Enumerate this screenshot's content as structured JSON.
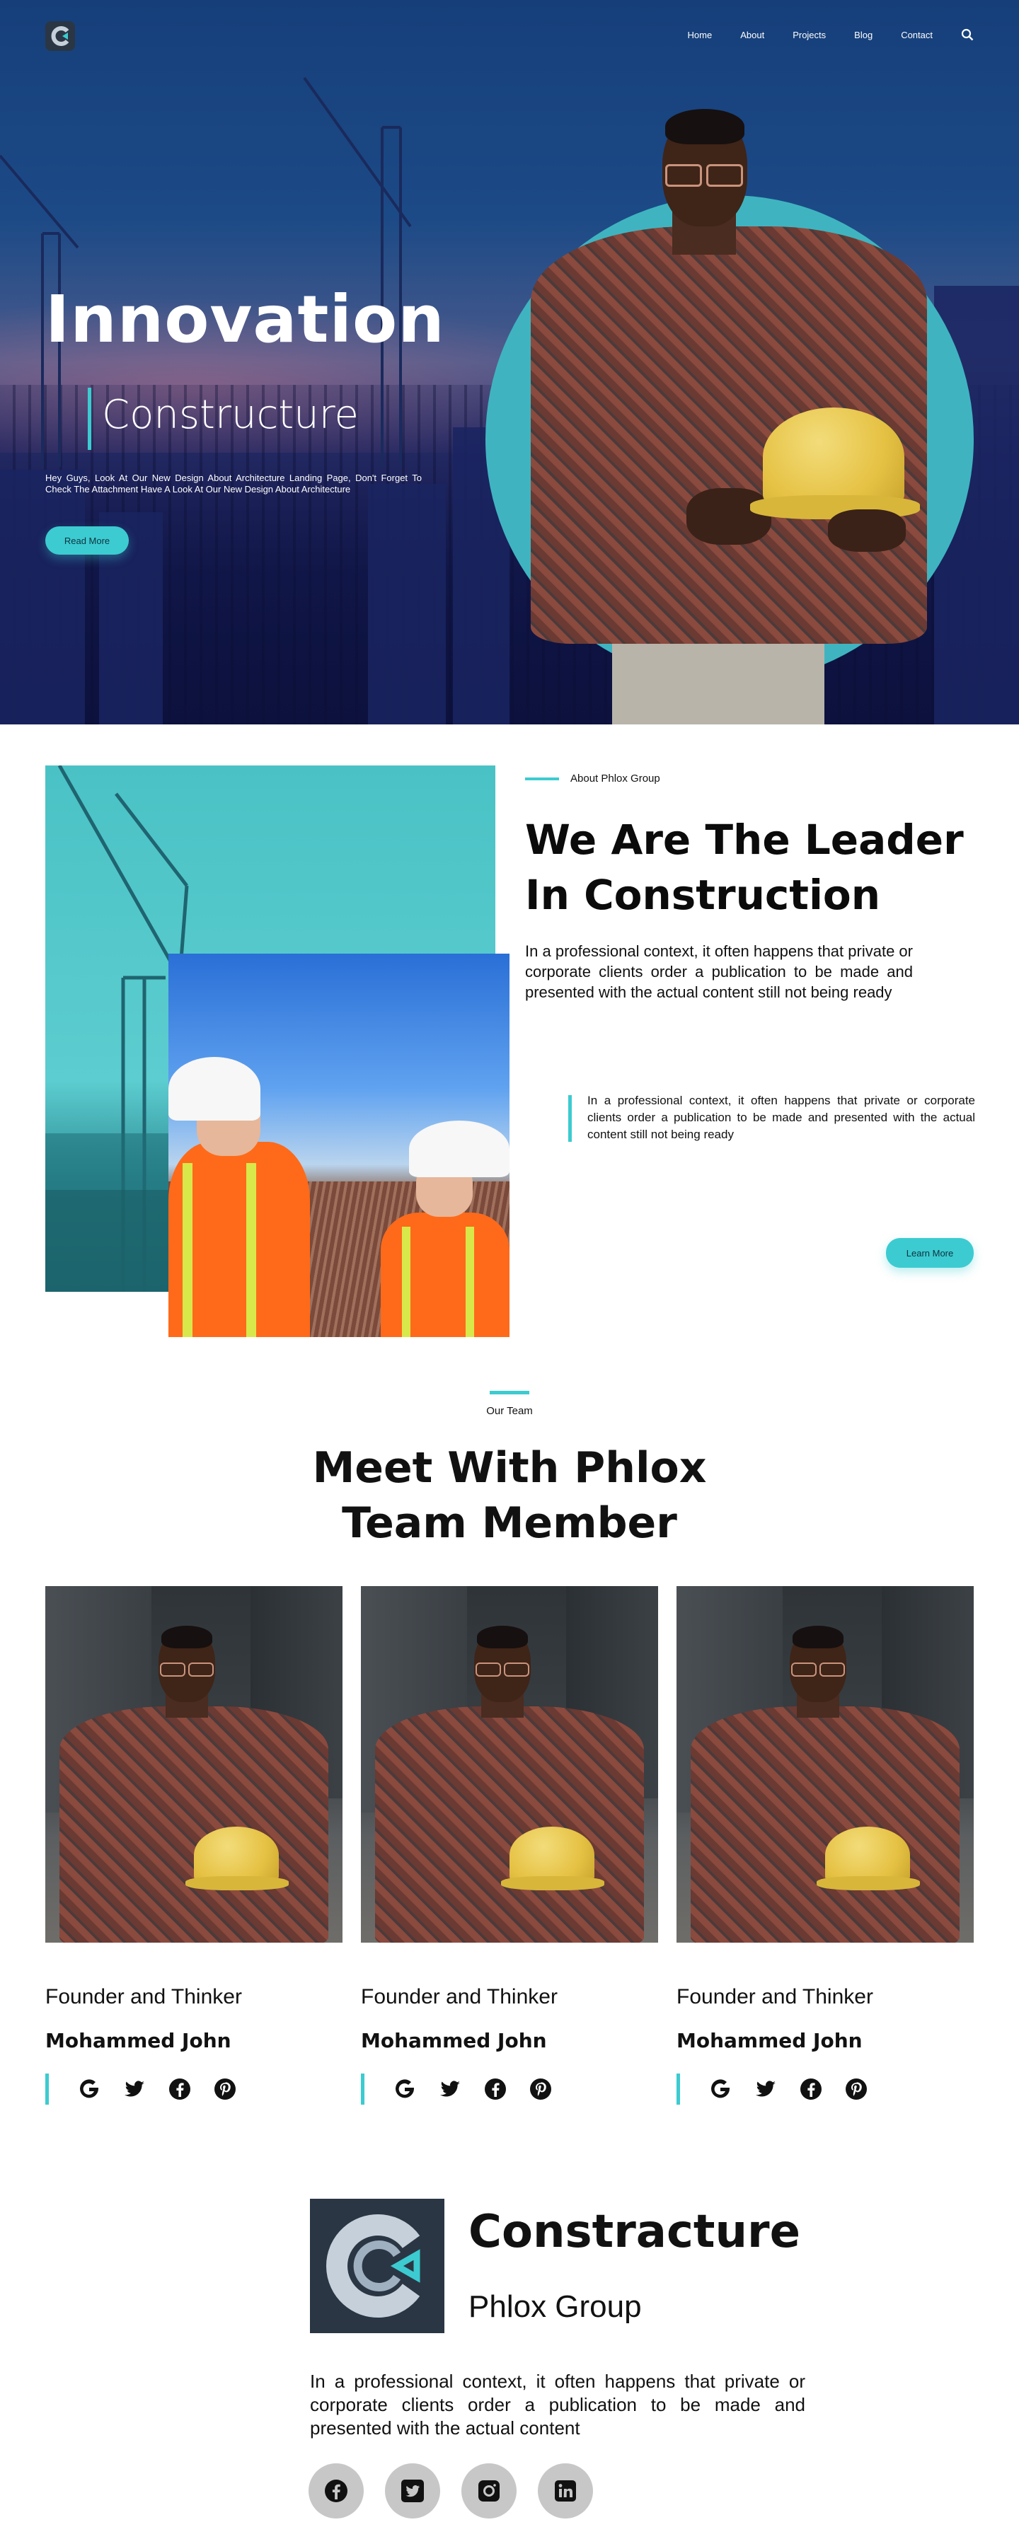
{
  "nav": {
    "items": [
      "Home",
      "About",
      "Projects",
      "Blog",
      "Contact"
    ]
  },
  "hero": {
    "title": "Innovation",
    "subtitle": "Constructure",
    "text": "Hey Guys, Look At Our New Design About Architecture Landing Page, Don't Forget To Check The Attachment Have A Look At Our New Design About Architecture",
    "button": "Read More"
  },
  "about": {
    "eyebrow": "About Phlox Group",
    "title": "We Are The Leader In Construction",
    "paragraph": "In a professional context, it often happens that private or corporate clients order a publication to be made and presented with the actual content still not being ready",
    "quote": "In a professional context, it often happens that private or corporate clients order a publication to be made and presented with the actual content still not being ready",
    "button": "Learn More"
  },
  "team": {
    "eyebrow": "Our Team",
    "title": "Meet With Phlox Team Member",
    "members": [
      {
        "role": "Founder and Thinker",
        "name": "Mohammed John"
      },
      {
        "role": "Founder and Thinker",
        "name": "Mohammed John"
      },
      {
        "role": "Founder and Thinker",
        "name": "Mohammed John"
      }
    ]
  },
  "footer": {
    "brand": "Constracture",
    "sub": "Phlox Group",
    "paragraph": "In a professional context, it often happens that private or corporate clients order a publication to be made and presented with the actual content",
    "socials": [
      "facebook-icon",
      "twitter-icon",
      "instagram-icon",
      "linkedin-icon"
    ]
  },
  "colors": {
    "accent": "#3ccbd0",
    "hero_dark": "#141b52",
    "logo_bg": "#2b3644"
  }
}
